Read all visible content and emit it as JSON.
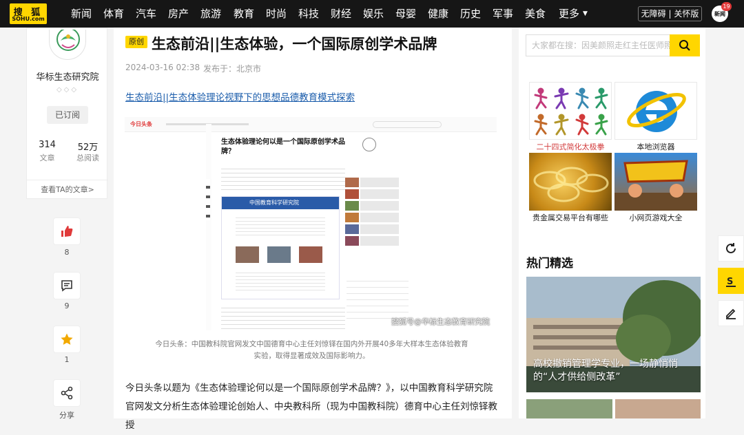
{
  "nav": {
    "logo_top": "搜 狐",
    "logo_bottom": "SOHU.com",
    "items": [
      "新闻",
      "体育",
      "汽车",
      "房产",
      "旅游",
      "教育",
      "时尚",
      "科技",
      "财经",
      "娱乐",
      "母婴",
      "健康",
      "历史",
      "军事",
      "美食",
      "更多"
    ],
    "accessibility": "无障碍 | 关怀版",
    "news_icon": "新闻",
    "badge": "19"
  },
  "author": {
    "name": "华标生态研究院",
    "subscribed": "已订阅",
    "articles_count": "314",
    "articles_label": "文章",
    "reads_count": "52万",
    "reads_label": "总阅读",
    "see_all": "查看TA的文章>"
  },
  "actions": {
    "like_count": "8",
    "comment_count": "9",
    "fav_count": "1",
    "share_label": "分享"
  },
  "article": {
    "original_tag": "原创",
    "title": "生态前沿||生态体验，一个国际原创学术品牌",
    "time": "2024-03-16 02:38",
    "location": "发布于：北京市",
    "link_text": "生态前沿||生态体验理论视野下的思想品德教育模式探索",
    "watermark": "搜狐号@华标生态教育研究院",
    "caption": "今日头条：中国教科院官网发文中国德育中心主任刘惊铎在国内外开展40多年大样本生态体验教育实验，取得显著成效及国际影响力。",
    "paragraph": "今日头条以题为《生态体验理论何以是一个国际原创学术品牌？》，以中国教育科学研究院官网发文分析生态体验理论创始人、中央教科所（现为中国教科院）德育中心主任刘惊铎教授",
    "inner": {
      "header_logo": "今日头条",
      "title": "生态体验理论何以是一个国际原创学术品牌？",
      "site_name": "中国教育科学研究院"
    }
  },
  "sidebar": {
    "search_placeholder": "大家都在搜：因美颜照走红主任医师照",
    "ads": [
      "二十四式简化太极拳",
      "本地浏览器",
      "贵金属交易平台有哪些",
      "小网页游戏大全"
    ],
    "hot_title": "热门精选",
    "hot_caption": "高校撤销管理学专业，一场静悄悄的“人才供给侧改革”"
  },
  "colors": {
    "accent": "#ffd600",
    "nav_bg": "#161616",
    "link": "#1a5cab",
    "like": "#e03a3a"
  }
}
